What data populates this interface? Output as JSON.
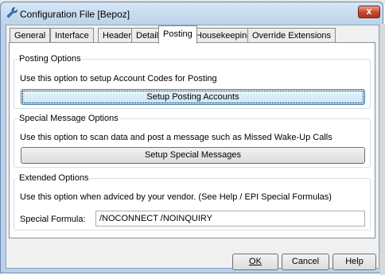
{
  "window": {
    "title": "Configuration File [Bepoz]",
    "close_symbol": "x",
    "icon": "wrench-icon"
  },
  "tabs": [
    {
      "label": "General"
    },
    {
      "label": "Interface"
    },
    {
      "label": "Header"
    },
    {
      "label": "Detail"
    },
    {
      "label": "Posting",
      "active": true
    },
    {
      "label": "Housekeeping"
    },
    {
      "label": "Override Extensions"
    }
  ],
  "posting_options": {
    "group_label": "Posting Options",
    "description": "Use this option to setup Account Codes for Posting",
    "button_label": "Setup Posting Accounts"
  },
  "special_message_options": {
    "group_label": "Special Message Options",
    "description": "Use this option to scan data and post a message such as Missed Wake-Up Calls",
    "button_label": "Setup Special Messages"
  },
  "extended_options": {
    "group_label": "Extended Options",
    "description": "Use this option when adviced by your vendor. (See Help / EPI Special Formulas)",
    "formula_label": "Special Formula:",
    "formula_value": "/NOCONNECT /NOINQUIRY"
  },
  "footer": {
    "ok_label": "OK",
    "cancel_label": "Cancel",
    "help_label": "Help"
  },
  "colors": {
    "window_frame": "#b9d1ea",
    "close_button": "#c7452c",
    "focused_button": "#c7e4f8"
  }
}
